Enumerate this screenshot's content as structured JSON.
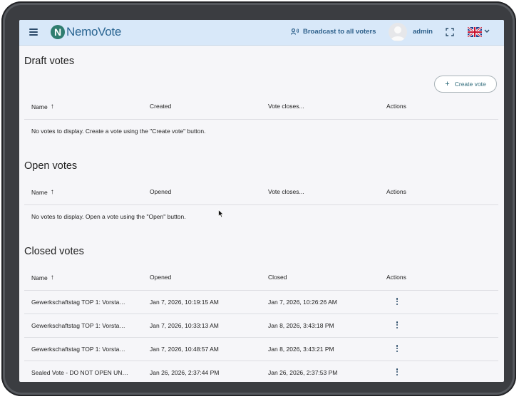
{
  "header": {
    "app_name": "NemoVote",
    "logo_letter": "N",
    "broadcast_label": "Broadcast to all voters",
    "user_name": "admin"
  },
  "draft": {
    "title": "Draft votes",
    "create_label": "Create vote",
    "columns": [
      "Name",
      "Created",
      "Vote closes...",
      "Actions"
    ],
    "empty_text": "No votes to display. Create a vote using the \"Create vote\" button."
  },
  "open": {
    "title": "Open votes",
    "columns": [
      "Name",
      "Opened",
      "Vote closes...",
      "Actions"
    ],
    "empty_text": "No votes to display. Open a vote using the \"Open\" button."
  },
  "closed": {
    "title": "Closed votes",
    "columns": [
      "Name",
      "Opened",
      "Closed",
      "Actions"
    ],
    "rows": [
      {
        "name": "Gewerkschaftstag TOP 1: Vorsta…",
        "opened": "Jan 7, 2026, 10:19:15 AM",
        "closed": "Jan 7, 2026, 10:26:26 AM"
      },
      {
        "name": "Gewerkschaftstag TOP 1: Vorsta…",
        "opened": "Jan 7, 2026, 10:33:13 AM",
        "closed": "Jan 8, 2026, 3:43:18 PM"
      },
      {
        "name": "Gewerkschaftstag TOP 1: Vorsta…",
        "opened": "Jan 7, 2026, 10:48:57 AM",
        "closed": "Jan 8, 2026, 3:43:21 PM"
      },
      {
        "name": "Sealed Vote - DO NOT OPEN UN…",
        "opened": "Jan 26, 2026, 2:37:44 PM",
        "closed": "Jan 26, 2026, 2:37:53 PM"
      }
    ]
  },
  "colors": {
    "header_bg": "#d8e8f9",
    "accent": "#2c5f8a",
    "logo_green": "#2f7d6f"
  }
}
